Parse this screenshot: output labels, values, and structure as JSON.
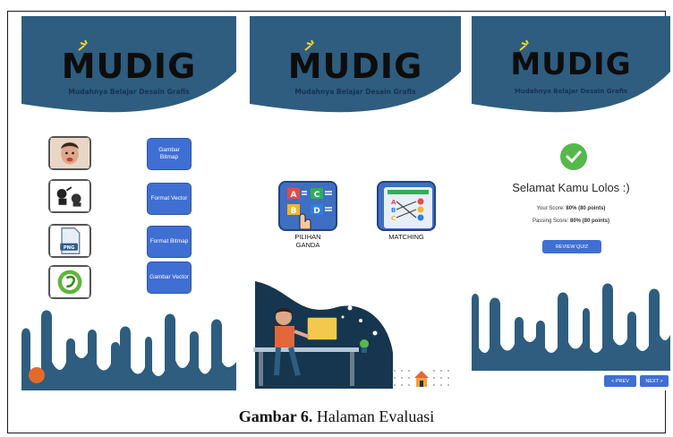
{
  "app": {
    "logo_text": "MUDIG",
    "tagline": "Mudahnya Belajar Desain Grafis"
  },
  "colors": {
    "header": "#2e5d7f",
    "button": "#3f6fd3",
    "success": "#55b94a",
    "back": "#e46a2a"
  },
  "screen1": {
    "buttons": [
      {
        "label": "Gambar Bitmap"
      },
      {
        "label": "Format Vector"
      },
      {
        "label": "Format Bitmap"
      },
      {
        "label": "Gambar Vector"
      }
    ],
    "thumbs": [
      "face-photo-icon",
      "vector-illustration-icon",
      "png-file-icon",
      "coreldraw-logo-icon"
    ]
  },
  "screen2": {
    "options": [
      {
        "label": "PILIHAN\nGANDA",
        "icon": "multiple-choice-icon"
      },
      {
        "label": "MATCHING",
        "icon": "matching-icon"
      }
    ]
  },
  "screen3": {
    "title": "Selamat Kamu Lolos :)",
    "your_score_label": "Your Score:",
    "your_score_value": "80% (80 points)",
    "passing_score_label": "Passing Score:",
    "passing_score_value": "80% (80 points)",
    "review_label": "REVIEW QUIZ",
    "prev_label": "< PREV",
    "next_label": "NEXT >"
  },
  "caption": {
    "label": "Gambar 6.",
    "text": " Halaman Evaluasi"
  }
}
